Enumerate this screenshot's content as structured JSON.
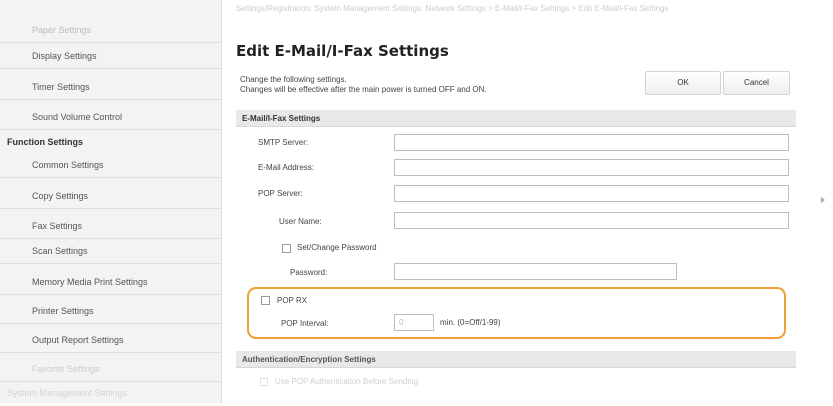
{
  "sidebar": {
    "items": [
      {
        "label": "Paper Settings",
        "kind": "top"
      },
      {
        "label": "Display Settings",
        "kind": "item"
      },
      {
        "label": "Timer Settings",
        "kind": "item"
      },
      {
        "label": "Sound Volume Control",
        "kind": "item"
      },
      {
        "label": "Function Settings",
        "kind": "group"
      },
      {
        "label": "Common Settings",
        "kind": "item"
      },
      {
        "label": "Copy Settings",
        "kind": "item"
      },
      {
        "label": "Fax Settings",
        "kind": "item"
      },
      {
        "label": "Scan Settings",
        "kind": "item"
      },
      {
        "label": "Memory Media Print Settings",
        "kind": "item"
      },
      {
        "label": "Printer Settings",
        "kind": "item"
      },
      {
        "label": "Output Report Settings",
        "kind": "item"
      },
      {
        "label": "Favorite Settings",
        "kind": "faded"
      },
      {
        "label": "System Management Settings",
        "kind": "bottom"
      }
    ]
  },
  "main": {
    "breadcrumb": "Settings/Registration: System Management Settings: Network Settings > E-Mail/I-Fax Settings > Edit E-Mail/I-Fax Settings",
    "title": "Edit E-Mail/I-Fax Settings",
    "description_line1": "Change the following settings.",
    "description_line2": "Changes will be effective after the main power is turned OFF and ON.",
    "ok_label": "OK",
    "cancel_label": "Cancel"
  },
  "email_section": {
    "header": "E-Mail/I-Fax Settings",
    "smtp_label": "SMTP Server:",
    "smtp_value": "",
    "email_label": "E-Mail Address:",
    "email_value": "",
    "pop_label": "POP Server:",
    "pop_value": "",
    "username_label": "User Name:",
    "username_value": "",
    "set_change_password_label": "Set/Change Password",
    "set_change_password_checked": false,
    "password_label": "Password:",
    "password_value": "",
    "pop_rx_label": "POP RX",
    "pop_rx_checked": false,
    "pop_interval_label": "POP Interval:",
    "pop_interval_value": "0",
    "pop_interval_unit": "min. (0=Off/1-99)"
  },
  "auth_section": {
    "header": "Authentication/Encryption Settings",
    "use_pop_auth_label": "Use POP Authentication Before Sending"
  },
  "colors": {
    "highlight": "#f0a030",
    "sidebar_bg": "#f3f3f3",
    "section_bg": "#e8e8e8"
  }
}
